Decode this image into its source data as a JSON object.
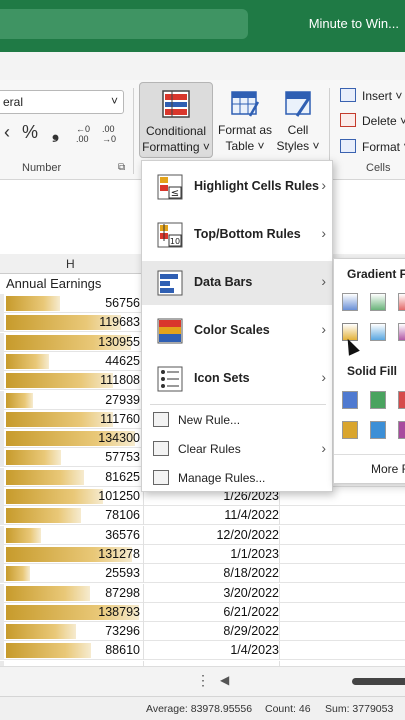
{
  "titlebar": {
    "title": "Minute to Win..."
  },
  "ribbon": {
    "number_format_value": "eral",
    "number_symbols": {
      "decrease": "‹",
      "percent": "%",
      "comma": "❟",
      "inc_decimal": "←0 .00",
      "dec_decimal": ".00 →0"
    },
    "number_group_label": "Number",
    "conditional_formatting": {
      "line1": "Conditional",
      "line2": "Formatting ˅"
    },
    "format_as_table": {
      "line1": "Format as",
      "line2": "Table ˅"
    },
    "cell_styles": {
      "line1": "Cell",
      "line2": "Styles ˅"
    },
    "cells_group": {
      "insert": "Insert ˅",
      "delete": "Delete ˅",
      "format": "Format ˅",
      "label": "Cells"
    }
  },
  "sheet": {
    "column_header": "H",
    "header_cell": "Annual Earnings",
    "max_value": 140000,
    "rows": [
      {
        "value": "56756",
        "date": ""
      },
      {
        "value": "119683",
        "date": ""
      },
      {
        "value": "130955",
        "date": ""
      },
      {
        "value": "44625",
        "date": ""
      },
      {
        "value": "111808",
        "date": ""
      },
      {
        "value": "27939",
        "date": ""
      },
      {
        "value": "111760",
        "date": ""
      },
      {
        "value": "134300",
        "date": ""
      },
      {
        "value": "57753",
        "date": ""
      },
      {
        "value": "81625",
        "date": ""
      },
      {
        "value": "101250",
        "date": "1/26/2023"
      },
      {
        "value": "78106",
        "date": "11/4/2022"
      },
      {
        "value": "36576",
        "date": "12/20/2022"
      },
      {
        "value": "131278",
        "date": "1/1/2023"
      },
      {
        "value": "25593",
        "date": "8/18/2022"
      },
      {
        "value": "87298",
        "date": "3/20/2022"
      },
      {
        "value": "138793",
        "date": "6/21/2022"
      },
      {
        "value": "73296",
        "date": "8/29/2022"
      },
      {
        "value": "88610",
        "date": "1/4/2023"
      },
      {
        "value": "",
        "date": ""
      }
    ]
  },
  "menu": {
    "highlight": "Highlight Cells Rules",
    "topbottom": "Top/Bottom Rules",
    "databars": "Data Bars",
    "colorscales": "Color Scales",
    "iconsets": "Icon Sets",
    "newrule": "New Rule...",
    "clearrules": "Clear Rules",
    "managerules": "Manage Rules...",
    "arrow": "›"
  },
  "submenu": {
    "gradient_fill": "Gradient F",
    "solid_fill": "Solid Fill",
    "more": "More R"
  },
  "statusbar": {
    "average": "Average: 83978.95556",
    "count": "Count: 46",
    "sum": "Sum: 3779053"
  },
  "colors": {
    "excel_green": "#1f7a45",
    "bar_gold": "#c79b2c"
  }
}
